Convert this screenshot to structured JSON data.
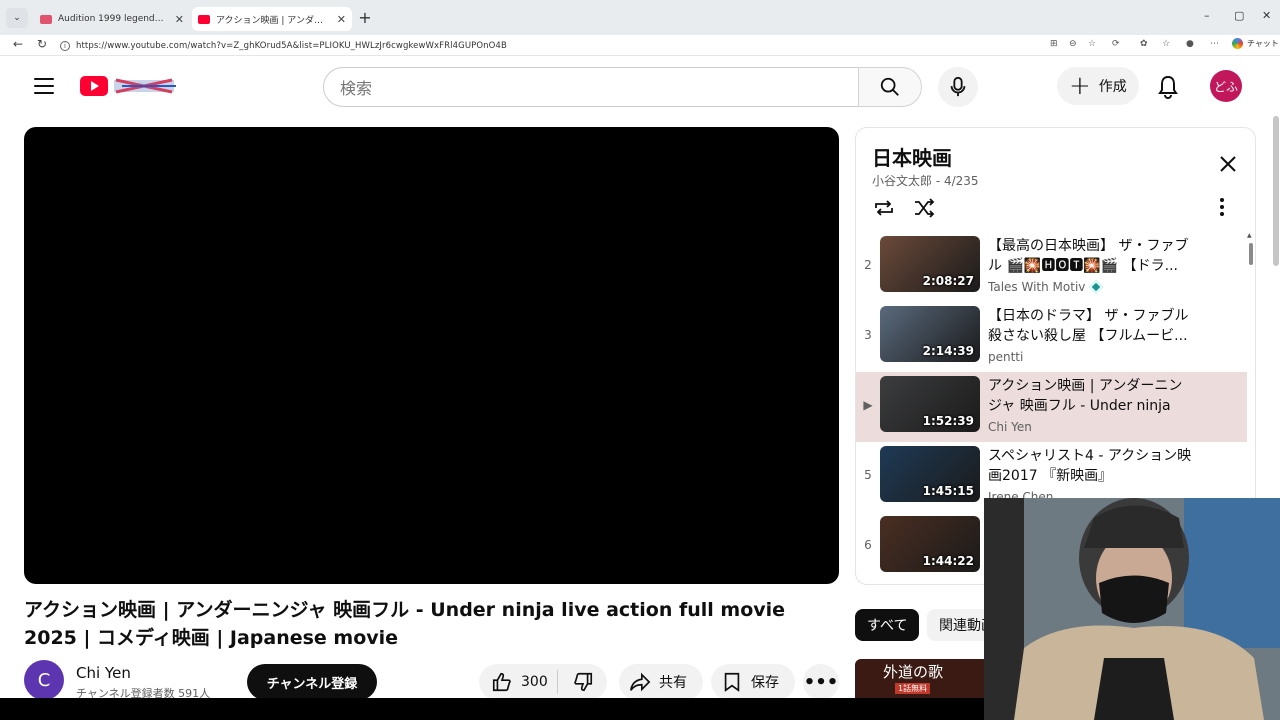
{
  "browser": {
    "tabs": [
      {
        "title": "Audition 1999 legendado - YouTub",
        "active": false
      },
      {
        "title": "アクション映画 | アンダーニンジャ 映画フ",
        "active": true
      }
    ],
    "new_tab": "+",
    "window_controls": {
      "minimize": "–",
      "maximize": "▢",
      "close": "✕"
    },
    "url": "https://www.youtube.com/watch?v=Z_ghKOrud5A&list=PLIOKU_HWLzJr6cwgkewWxFRl4GUPOnO4B",
    "chat_label": "チャット"
  },
  "masthead": {
    "search_placeholder": "検索",
    "create_label": "作成",
    "avatar_text": "どふ"
  },
  "video": {
    "title": "アクション映画 | アンダーニンジャ 映画フル - Under ninja live action full movie 2025 | コメディ映画 | Japanese movie",
    "channel_initial": "C",
    "channel_name": "Chi Yen",
    "subscribers": "チャンネル登録者数 591人",
    "subscribe_label": "チャンネル登録",
    "like_count": "300",
    "share_label": "共有",
    "save_label": "保存",
    "more_label": "•••"
  },
  "playlist": {
    "title": "日本映画",
    "owner": "小谷文太郎",
    "position": "4/235",
    "items": [
      {
        "index": "2",
        "title": "【最高の日本映画】 ザ・ファブル 🎬🎇🅷🅾🆃🎇🎬 【ドラ...",
        "channel": "Tales With Motiv",
        "duration": "2:08:27",
        "verified": true,
        "active": false,
        "thumb_color": "#6b4a3a"
      },
      {
        "index": "3",
        "title": "【日本のドラマ】 ザ・ファブル 殺さない殺し屋 【フルムービ...",
        "channel": "pentti",
        "duration": "2:14:39",
        "verified": false,
        "active": false,
        "thumb_color": "#5a6a7d"
      },
      {
        "index": "▶",
        "title": "アクション映画 | アンダーニンジャ 映画フル - Under ninja liv...",
        "channel": "Chi Yen",
        "duration": "1:52:39",
        "verified": false,
        "active": true,
        "thumb_color": "#3c3d3f"
      },
      {
        "index": "5",
        "title": "スペシャリスト4 - アクション映画2017 『新映画』",
        "channel": "Irene Chen",
        "duration": "1:45:15",
        "verified": false,
        "active": false,
        "thumb_color": "#1f3a56"
      },
      {
        "index": "6",
        "title": "",
        "channel": "",
        "duration": "1:44:22",
        "verified": false,
        "active": false,
        "thumb_color": "#4a2e22"
      }
    ]
  },
  "chips": [
    {
      "label": "すべて",
      "active": true
    },
    {
      "label": "関連動画",
      "active": false
    }
  ],
  "recommendation": {
    "thumb_title": "外道の歌",
    "thumb_badge": "1話無料"
  },
  "colors": {
    "brand_red": "#ff0033",
    "active_row": "#ecdcdc",
    "avatar": "#c2185b"
  }
}
